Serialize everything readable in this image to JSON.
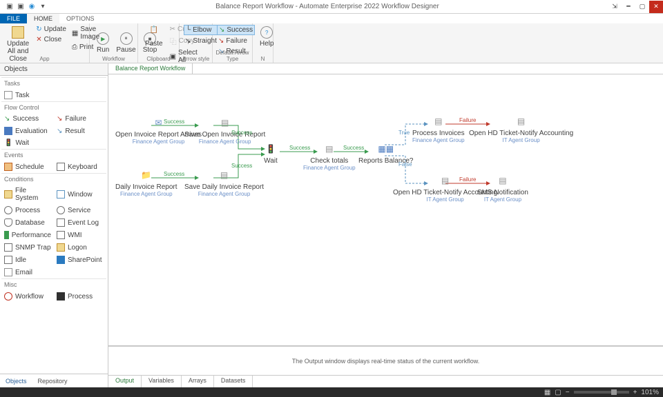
{
  "titlebar": {
    "title": "Balance Report Workflow - Automate Enterprise 2022 Workflow Designer"
  },
  "tabs": {
    "file": "FILE",
    "home": "HOME",
    "options": "OPTIONS"
  },
  "ribbon": {
    "app": {
      "update": "Update All and Close",
      "updateBtn": "Update",
      "saveImage": "Save Image",
      "close": "Close",
      "print": "Print",
      "group": "App"
    },
    "workflow": {
      "run": "Run",
      "pause": "Pause",
      "stop": "Stop",
      "group": "Workflow"
    },
    "clipboard": {
      "paste": "Paste",
      "cut": "Cut",
      "copy": "Copy",
      "selectAll": "Select All",
      "group": "Clipboard"
    },
    "arrow": {
      "elbow": "Elbow",
      "straight": "Straight",
      "group": "Arrow style"
    },
    "defarrow": {
      "success": "Success",
      "failure": "Failure",
      "result": "Result",
      "group": "Default Arrow Type"
    },
    "help": {
      "help": "Help",
      "group": "N"
    }
  },
  "leftPanel": {
    "header": "Objects",
    "sections": {
      "tasks": "Tasks",
      "flow": "Flow Control",
      "events": "Events",
      "conditions": "Conditions",
      "misc": "Misc"
    },
    "items": {
      "task": "Task",
      "success": "Success",
      "failure": "Failure",
      "evaluation": "Evaluation",
      "result": "Result",
      "wait": "Wait",
      "schedule": "Schedule",
      "keyboard": "Keyboard",
      "filesystem": "File System",
      "window": "Window",
      "process": "Process",
      "service": "Service",
      "database": "Database",
      "eventlog": "Event Log",
      "performance": "Performance",
      "wmi": "WMI",
      "snmptrap": "SNMP Trap",
      "logon": "Logon",
      "idle": "Idle",
      "sharepoint": "SharePoint",
      "email": "Email",
      "workflow": "Workflow",
      "process2": "Process"
    },
    "tabs": {
      "objects": "Objects",
      "repository": "Repository"
    }
  },
  "docTab": "Balance Report Workflow",
  "nodes": {
    "n1": {
      "label": "Open Invoice Report Arrives",
      "group": "Finance Agent Group"
    },
    "n2": {
      "label": "Save Open Invoice Report",
      "group": "Finance Agent Group"
    },
    "n3": {
      "label": "Daily Invoice Report",
      "group": "Finance Agent Group"
    },
    "n4": {
      "label": "Save Daily Invoice Report",
      "group": "Finance Agent Group"
    },
    "n5": {
      "label": "Wait"
    },
    "n6": {
      "label": "Check totals",
      "group": "Finance Agent Group"
    },
    "n7": {
      "label": "Reports Balance?"
    },
    "n8": {
      "label": "Process Invoices",
      "group": "Finance Agent Group"
    },
    "n9": {
      "label": "Open HD Ticket-Notify Accounting",
      "group": "IT Agent Group"
    },
    "n10": {
      "label": "Open HD Ticket-Notify Accounting",
      "group": "IT Agent Group"
    },
    "n11": {
      "label": "SMS Notification",
      "group": "IT Agent Group"
    }
  },
  "labels": {
    "success": "Success",
    "failure": "Failure",
    "true": "True",
    "false": "False"
  },
  "output": {
    "message": "The Output window displays real-time status of the current workflow.",
    "tabs": {
      "output": "Output",
      "variables": "Variables",
      "arrays": "Arrays",
      "datasets": "Datasets"
    }
  },
  "status": {
    "zoom": "101%"
  }
}
